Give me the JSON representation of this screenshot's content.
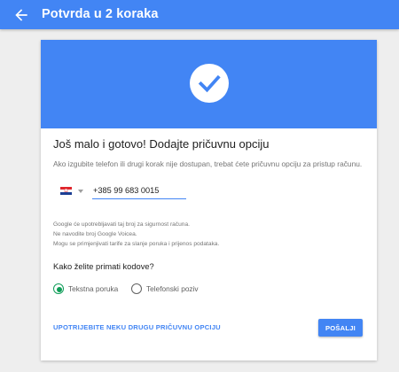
{
  "appbar": {
    "title": "Potvrda u 2 koraka",
    "back_icon": "arrow-back-icon",
    "color": "#4285f4"
  },
  "hero": {
    "icon": "check-circle-icon",
    "color": "#4285f4"
  },
  "content": {
    "headline": "Još malo i gotovo! Dodajte pričuvnu opciju",
    "description": "Ako izgubite telefon ili drugi korak nije dostupan, trebat ćete pričuvnu opciju za pristup računu.",
    "phone": {
      "country_flag": "croatia-flag-icon",
      "value": "+385 99 683 0015"
    },
    "notes": [
      "Google će upotrebljavati taj broj za sigurnost računa.",
      "Ne navodite broj Google Voicea.",
      "Mogu se primjenjivati tarife za slanje poruka i prijenos podataka."
    ],
    "question": "Kako želite primati kodove?",
    "options": [
      {
        "label": "Tekstna poruka",
        "selected": true
      },
      {
        "label": "Telefonski poziv",
        "selected": false
      }
    ],
    "accent_selected": "#0f9d58"
  },
  "actions": {
    "alt_option_link": "UPOTRIJEBITE NEKU DRUGU PRIČUVNU OPCIJU",
    "send_button": "POŠALJI"
  }
}
